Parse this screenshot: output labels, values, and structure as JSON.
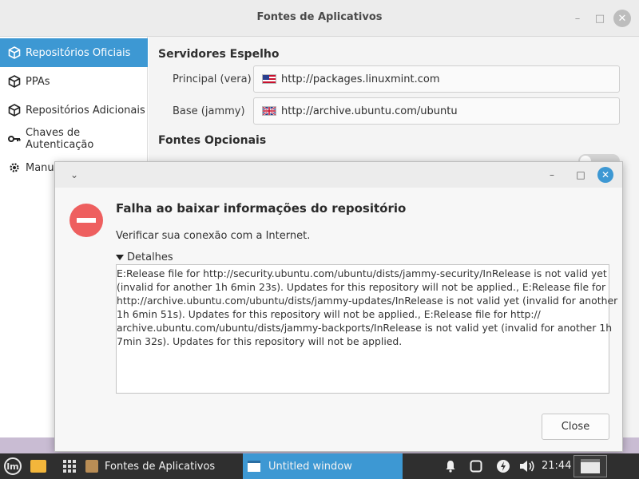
{
  "main_window": {
    "title": "Fontes de Aplicativos",
    "controls": {
      "minimize": "–",
      "maximize": "□",
      "close": "✕"
    }
  },
  "sidebar": {
    "items": [
      {
        "label": "Repositórios Oficiais",
        "icon": "package-icon",
        "active": true
      },
      {
        "label": "PPAs",
        "icon": "package-icon",
        "active": false
      },
      {
        "label": "Repositórios Adicionais",
        "icon": "package-icon",
        "active": false
      },
      {
        "label": "Chaves de Autenticação",
        "icon": "key-icon",
        "active": false
      },
      {
        "label": "Manu",
        "icon": "gear-icon",
        "active": false
      }
    ]
  },
  "mirrors": {
    "section_title": "Servidores Espelho",
    "main_label": "Principal (vera)",
    "main_url": "http://packages.linuxmint.com",
    "main_flag": "us-flag-icon",
    "base_label": "Base (jammy)",
    "base_url": "http://archive.ubuntu.com/ubuntu",
    "base_flag": "uk-flag-icon"
  },
  "optional": {
    "section_title": "Fontes Opcionais",
    "source_code_toggle_on": false
  },
  "dialog": {
    "controls": {
      "collapse": "⌄",
      "minimize": "–",
      "maximize": "□",
      "close": "✕"
    },
    "heading": "Falha ao baixar informações do repositório",
    "message": "Verificar sua conexão com a Internet.",
    "details_label": "Detalhes",
    "details_lines": [
      "E:Release file for http://security.ubuntu.com/ubuntu/dists/jammy-security/InRelease is not valid yet",
      "(invalid for another 1h 6min 23s). Updates for this repository will not be applied., E:Release file for",
      "http://archive.ubuntu.com/ubuntu/dists/jammy-updates/InRelease is not valid yet (invalid for another",
      "1h 6min 51s). Updates for this repository will not be applied., E:Release file for http://",
      "archive.ubuntu.com/ubuntu/dists/jammy-backports/InRelease is not valid yet (invalid for another 1h",
      "7min 32s). Updates for this repository will not be applied."
    ],
    "close_button": "Close"
  },
  "taskbar": {
    "menu_icon": "linux-mint-menu-icon",
    "tasks": [
      {
        "label": "Fontes de Aplicativos",
        "active": false
      },
      {
        "label": "Untitled window",
        "active": true
      }
    ],
    "tray_icons": [
      "bell-icon",
      "update-manager-icon",
      "power-icon",
      "volume-icon"
    ],
    "clock": "21:44"
  },
  "colors": {
    "accent": "#3d98d3",
    "error_red": "#ee5f5f",
    "taskbar": "#2f2f2f",
    "folder": "#f3b63b"
  }
}
